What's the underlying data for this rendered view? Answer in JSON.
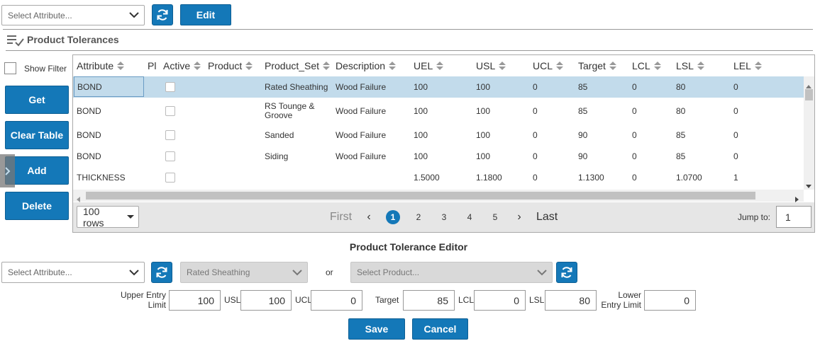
{
  "top": {
    "attribute_select": "Select Attribute...",
    "edit_label": "Edit"
  },
  "section": {
    "title": "Product Tolerances"
  },
  "sidebar": {
    "show_filter": "Show Filter",
    "get": "Get",
    "clear_table": "Clear Table",
    "add": "Add",
    "delete": "Delete"
  },
  "grid": {
    "columns": [
      "Attribute",
      "Pl",
      "Active",
      "Product",
      "Product_Set",
      "Description",
      "UEL",
      "USL",
      "UCL",
      "Target",
      "LCL",
      "LSL",
      "LEL"
    ],
    "rows": [
      {
        "attribute": "BOND",
        "product_set": "Rated Sheathing",
        "description": "Wood Failure",
        "uel": "100",
        "usl": "100",
        "ucl": "0",
        "target": "85",
        "lcl": "0",
        "lsl": "80",
        "lel": "0"
      },
      {
        "attribute": "BOND",
        "product_set": "RS Tounge & Groove",
        "description": "Wood Failure",
        "uel": "100",
        "usl": "100",
        "ucl": "0",
        "target": "85",
        "lcl": "0",
        "lsl": "80",
        "lel": "0"
      },
      {
        "attribute": "BOND",
        "product_set": "Sanded",
        "description": "Wood Failure",
        "uel": "100",
        "usl": "100",
        "ucl": "0",
        "target": "90",
        "lcl": "0",
        "lsl": "85",
        "lel": "0"
      },
      {
        "attribute": "BOND",
        "product_set": "Siding",
        "description": "Wood Failure",
        "uel": "100",
        "usl": "100",
        "ucl": "0",
        "target": "90",
        "lcl": "0",
        "lsl": "85",
        "lel": "0"
      },
      {
        "attribute": "THICKNESS",
        "product_set": "",
        "description": "",
        "uel": "1.5000",
        "usl": "1.1800",
        "ucl": "0",
        "target": "1.1300",
        "lcl": "0",
        "lsl": "1.0700",
        "lel": "1"
      }
    ]
  },
  "pager": {
    "rows_select": "100 rows",
    "first": "First",
    "prev": "‹",
    "pages": [
      "1",
      "2",
      "3",
      "4",
      "5"
    ],
    "next": "›",
    "last": "Last",
    "jump_label": "Jump to:",
    "jump_value": "1"
  },
  "editor": {
    "title": "Product Tolerance Editor",
    "attribute_select": "Select Attribute...",
    "product_set_select": "Rated Sheathing",
    "or": "or",
    "product_select": "Select Product...",
    "uel_label": "Upper Entry Limit",
    "uel_value": "100",
    "usl_label": "USL",
    "usl_value": "100",
    "ucl_label": "UCL",
    "ucl_value": "0",
    "target_label": "Target",
    "target_value": "85",
    "lcl_label": "LCL",
    "lcl_value": "0",
    "lsl_label": "LSL",
    "lsl_value": "80",
    "lel_label": "Lower Entry Limit",
    "lel_value": "0",
    "save": "Save",
    "cancel": "Cancel"
  },
  "colors": {
    "accent": "#1478b8",
    "selected_row": "#c2dbeb"
  },
  "icons": {
    "refresh": "refresh-icon",
    "chevron": "chevron-down-icon",
    "section": "list-check-icon"
  }
}
